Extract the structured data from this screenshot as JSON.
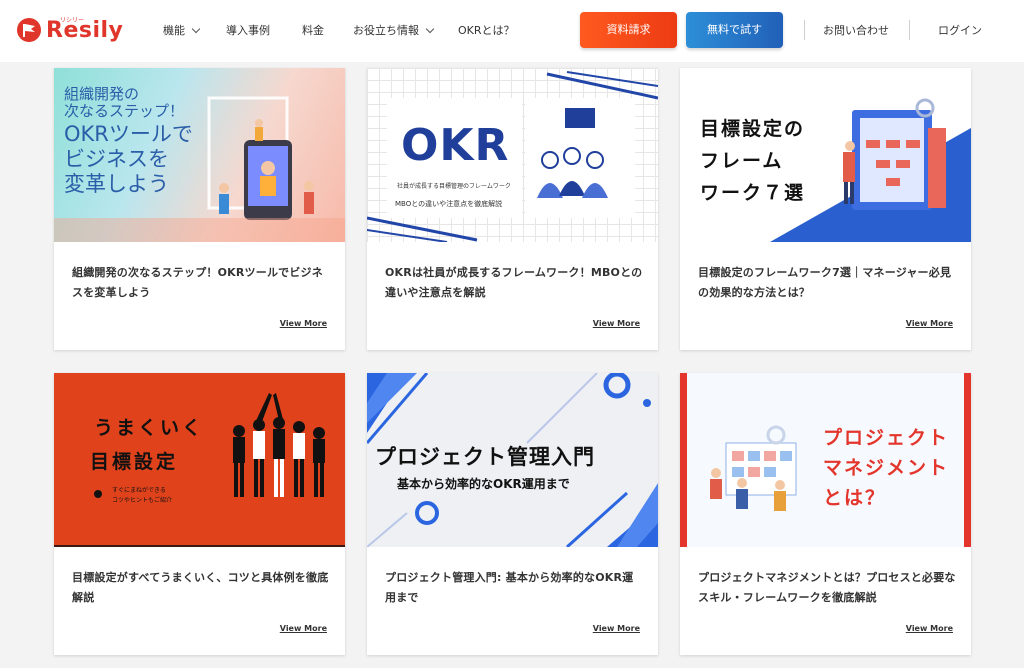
{
  "header": {
    "logo_text": "Resily",
    "logo_ruby": "リシリー",
    "nav": [
      {
        "label": "機能"
      },
      {
        "label": "導入事例"
      },
      {
        "label": "料金"
      },
      {
        "label": "お役立ち情報"
      },
      {
        "label": "OKRとは？"
      }
    ],
    "cta_request": "資料請求",
    "cta_trial": "無料で試す",
    "contact": "お問い合わせ",
    "login": "ログイン"
  },
  "colors": {
    "brand_red": "#e0352b",
    "cta_orange": "#f04a18",
    "cta_blue": "#2878c8"
  },
  "cards": [
    {
      "title": "組織開発の次なるステップ！OKRツールでビジネスを変革しよう",
      "view_more": "View More",
      "thumb": {
        "line1": "組織開発の",
        "line2": "次なるステップ！",
        "big1": "OKRツールで",
        "big2": "ビジネスを",
        "big3": "変革しよう"
      }
    },
    {
      "title": "OKRは社員が成長するフレームワーク！MBOとの違いや注意点を解説",
      "view_more": "View More",
      "thumb": {
        "big": "OKR",
        "sub": "社員が成長する目標管理のフレームワーク",
        "caption": "MBOとの違いや注意点を徹底解説"
      }
    },
    {
      "title": "目標設定のフレームワーク7選｜マネージャー必見の効果的な方法とは？",
      "view_more": "View More",
      "thumb": {
        "line1": "目標設定の",
        "line2": "フレーム",
        "line3": "ワーク７選"
      }
    },
    {
      "title": "目標設定がすべてうまくいく、コツと具体例を徹底解説",
      "view_more": "View More",
      "thumb": {
        "line1": "うまくいく",
        "line2": "目標設定",
        "sub1": "すぐにまねができる",
        "sub2": "コツやヒントもご紹介"
      }
    },
    {
      "title": "プロジェクト管理入門: 基本から効率的なOKR運用まで",
      "view_more": "View More",
      "thumb": {
        "big": "プロジェクト管理入門",
        "sub": "基本から効率的なOKR運用まで"
      }
    },
    {
      "title": "プロジェクトマネジメントとは？プロセスと必要なスキル・フレームワークを徹底解説",
      "view_more": "View More",
      "thumb": {
        "line1": "プロジェクト",
        "line2": "マネジメント",
        "line3": "とは？"
      }
    }
  ]
}
